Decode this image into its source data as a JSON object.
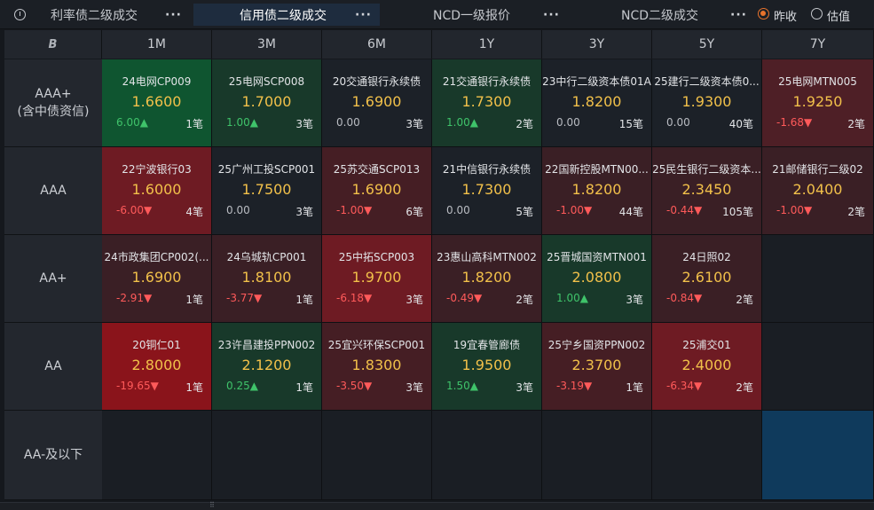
{
  "tabs": [
    {
      "label": "利率债二级成交",
      "more": "···"
    },
    {
      "label": "信用债二级成交",
      "more": "···"
    },
    {
      "label": "NCD一级报价",
      "more": "···"
    },
    {
      "label": "NCD二级成交",
      "more": "···"
    }
  ],
  "radio": {
    "yesterday": "昨收",
    "estimate": "估值"
  },
  "corner_icon": "B",
  "columns": [
    "1M",
    "3M",
    "6M",
    "1Y",
    "3Y",
    "5Y",
    "7Y"
  ],
  "rows": [
    {
      "label": "AAA+",
      "sub": "(含中债资信)"
    },
    {
      "label": "AAA",
      "sub": ""
    },
    {
      "label": "AA+",
      "sub": ""
    },
    {
      "label": "AA",
      "sub": ""
    },
    {
      "label": "AA-及以下",
      "sub": ""
    }
  ],
  "cells": [
    [
      {
        "name": "24电网CP009",
        "yield": "1.6600",
        "change": "6.00▲",
        "count": "1笔",
        "dir": "up"
      },
      {
        "name": "25电网SCP008",
        "yield": "1.7000",
        "change": "1.00▲",
        "count": "3笔",
        "dir": "up"
      },
      {
        "name": "20交通银行永续债",
        "yield": "1.6900",
        "change": "0.00",
        "count": "3笔",
        "dir": "flat"
      },
      {
        "name": "21交通银行永续债",
        "yield": "1.7300",
        "change": "1.00▲",
        "count": "2笔",
        "dir": "up"
      },
      {
        "name": "23中行二级资本债01A",
        "yield": "1.8200",
        "change": "0.00",
        "count": "15笔",
        "dir": "flat"
      },
      {
        "name": "25建行二级资本债0...",
        "yield": "1.9300",
        "change": "0.00",
        "count": "40笔",
        "dir": "flat"
      },
      {
        "name": "25电网MTN005",
        "yield": "1.9250",
        "change": "-1.68▼",
        "count": "2笔",
        "dir": "down"
      }
    ],
    [
      {
        "name": "22宁波银行03",
        "yield": "1.6000",
        "change": "-6.00▼",
        "count": "4笔",
        "dir": "down"
      },
      {
        "name": "25广州工投SCP001",
        "yield": "1.7500",
        "change": "0.00",
        "count": "3笔",
        "dir": "flat"
      },
      {
        "name": "25苏交通SCP013",
        "yield": "1.6900",
        "change": "-1.00▼",
        "count": "6笔",
        "dir": "down"
      },
      {
        "name": "21中信银行永续债",
        "yield": "1.7300",
        "change": "0.00",
        "count": "5笔",
        "dir": "flat"
      },
      {
        "name": "22国新控股MTN00...",
        "yield": "1.8200",
        "change": "-1.00▼",
        "count": "44笔",
        "dir": "down"
      },
      {
        "name": "25民生银行二级资本...",
        "yield": "2.3450",
        "change": "-0.44▼",
        "count": "105笔",
        "dir": "down"
      },
      {
        "name": "21邮储银行二级02",
        "yield": "2.0400",
        "change": "-1.00▼",
        "count": "2笔",
        "dir": "down"
      }
    ],
    [
      {
        "name": "24市政集团CP002(...",
        "yield": "1.6900",
        "change": "-2.91▼",
        "count": "1笔",
        "dir": "down"
      },
      {
        "name": "24乌城轨CP001",
        "yield": "1.8100",
        "change": "-3.77▼",
        "count": "1笔",
        "dir": "down"
      },
      {
        "name": "25中拓SCP003",
        "yield": "1.9700",
        "change": "-6.18▼",
        "count": "3笔",
        "dir": "down"
      },
      {
        "name": "23惠山高科MTN002",
        "yield": "1.8200",
        "change": "-0.49▼",
        "count": "2笔",
        "dir": "down"
      },
      {
        "name": "25晋城国资MTN001",
        "yield": "2.0800",
        "change": "1.00▲",
        "count": "3笔",
        "dir": "up"
      },
      {
        "name": "24日照02",
        "yield": "2.6100",
        "change": "-0.84▼",
        "count": "2笔",
        "dir": "down"
      },
      null
    ],
    [
      {
        "name": "20铜仁01",
        "yield": "2.8000",
        "change": "-19.65▼",
        "count": "1笔",
        "dir": "down"
      },
      {
        "name": "23许昌建投PPN002",
        "yield": "2.1200",
        "change": "0.25▲",
        "count": "1笔",
        "dir": "up"
      },
      {
        "name": "25宜兴环保SCP001",
        "yield": "1.8300",
        "change": "-3.50▼",
        "count": "3笔",
        "dir": "down"
      },
      {
        "name": "19宜春管廊债",
        "yield": "1.9500",
        "change": "1.50▲",
        "count": "3笔",
        "dir": "up"
      },
      {
        "name": "25宁乡国资PPN002",
        "yield": "2.3700",
        "change": "-3.19▼",
        "count": "1笔",
        "dir": "down"
      },
      {
        "name": "25浦交01",
        "yield": "2.4000",
        "change": "-6.34▼",
        "count": "2笔",
        "dir": "down"
      },
      null
    ],
    [
      null,
      null,
      null,
      null,
      null,
      null,
      null
    ]
  ],
  "colors": {
    "up_text": "#3fc36a",
    "down_text": "#ff5a5a",
    "yield_text": "#f1c04a",
    "active_tab": "#1e2c3e",
    "radio_on": "#e9732c",
    "empty_cell": "#1a1e24",
    "highlight_cell": "#0f3a5c"
  },
  "cell_backgrounds": [
    [
      "#0f5530",
      "#18392a",
      "#1c2128",
      "#18392a",
      "#1c2128",
      "#1c2128",
      "#4e1f26"
    ],
    [
      "#6e1b23",
      "#1c2128",
      "#451e24",
      "#1c2128",
      "#3a1f25",
      "#3a1f25",
      "#3a1f25"
    ],
    [
      "#3a1f25",
      "#3a1f25",
      "#6e1b23",
      "#3a1f25",
      "#18392a",
      "#3a1f25",
      "#1a1e24"
    ],
    [
      "#8a141b",
      "#18392a",
      "#451e24",
      "#18392a",
      "#451e24",
      "#6e1b23",
      "#1a1e24"
    ],
    [
      "#1a1e24",
      "#1a1e24",
      "#1a1e24",
      "#1a1e24",
      "#1a1e24",
      "#1a1e24",
      "#0f3a5c"
    ]
  ]
}
